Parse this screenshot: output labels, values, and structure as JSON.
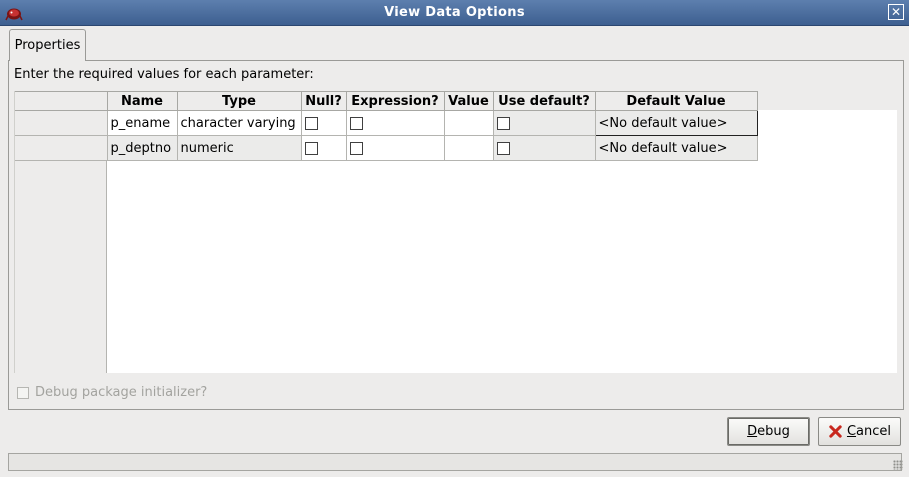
{
  "window": {
    "title": "View Data Options",
    "close_glyph": "✕"
  },
  "tabs": [
    {
      "label": "Properties"
    }
  ],
  "instruction": "Enter the required values for each parameter:",
  "grid": {
    "columns": [
      "Name",
      "Type",
      "Null?",
      "Expression?",
      "Value",
      "Use default?",
      "Default Value"
    ],
    "rows": [
      {
        "name": "p_ename",
        "type": "character varying",
        "null": false,
        "expression": false,
        "value": "",
        "use_default": false,
        "default_value": "<No default value>"
      },
      {
        "name": "p_deptno",
        "type": "numeric",
        "null": false,
        "expression": false,
        "value": "",
        "use_default": false,
        "default_value": "<No default value>"
      }
    ]
  },
  "debug_initializer": {
    "label": "Debug package initializer?",
    "checked": false,
    "enabled": false
  },
  "buttons": {
    "debug": {
      "mnemonic": "D",
      "rest": "ebug"
    },
    "cancel": {
      "mnemonic": "C",
      "rest": "ancel"
    }
  },
  "icons": {
    "app": "elephant-logo-icon",
    "cancel": "red-x-icon",
    "close": "close-icon"
  },
  "colors": {
    "titlebar": "#4a6d9e",
    "cancel_icon": "#c8281e"
  }
}
